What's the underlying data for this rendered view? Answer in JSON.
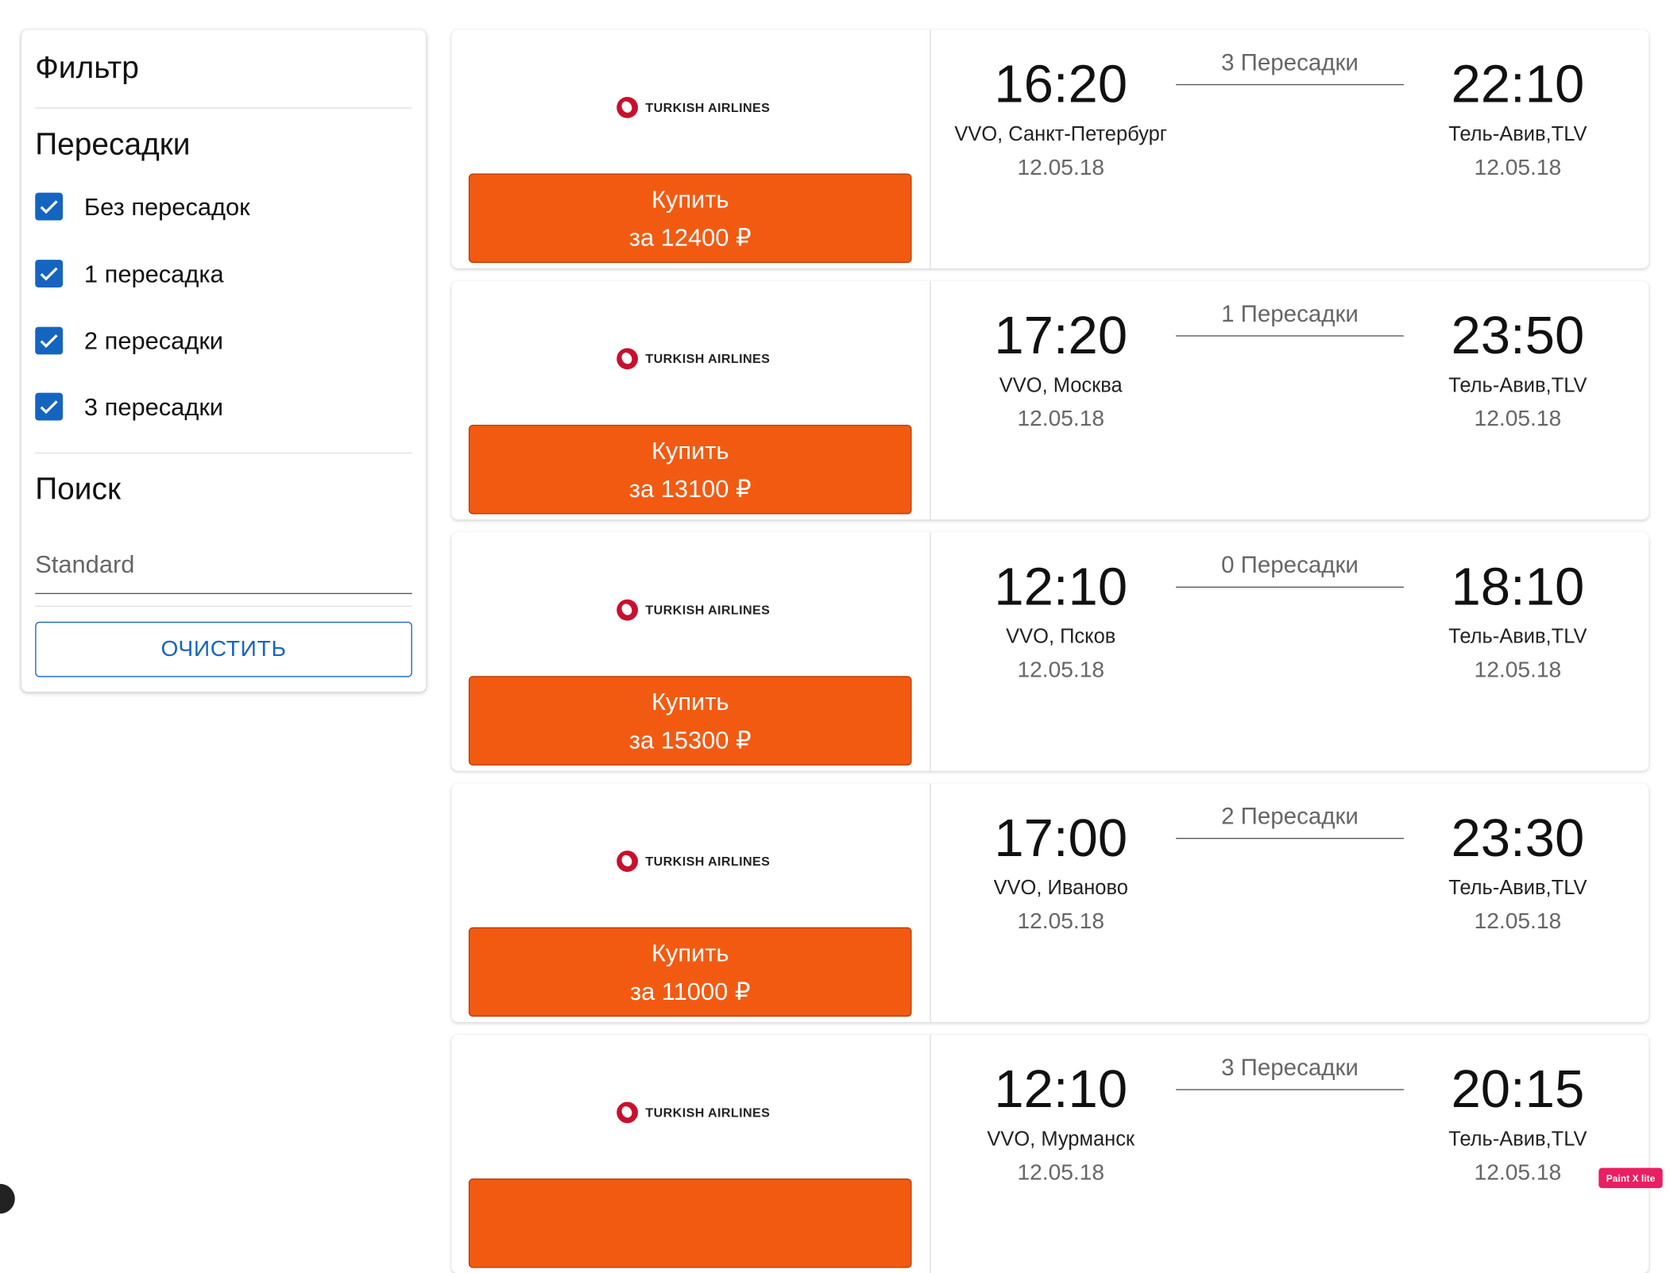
{
  "filter": {
    "title": "Фильтр",
    "stops_heading": "Пересадки",
    "options": [
      {
        "label": "Без пересадок",
        "checked": true
      },
      {
        "label": "1 пересадка",
        "checked": true
      },
      {
        "label": "2 пересадки",
        "checked": true
      },
      {
        "label": "3 пересадки",
        "checked": true
      }
    ],
    "search_heading": "Поиск",
    "search_placeholder": "Standard",
    "clear_label": "ОЧИСТИТЬ"
  },
  "tickets": [
    {
      "airline": "TURKISH AIRLINES",
      "buy_label": "Купить",
      "price_label": "за 12400 ₽",
      "stops_label": "3 Пересадки",
      "dep_time": "16:20",
      "dep_city": "VVO, Санкт-Петербург",
      "dep_date": "12.05.18",
      "arr_time": "22:10",
      "arr_city": "Тель-Авив,TLV",
      "arr_date": "12.05.18"
    },
    {
      "airline": "TURKISH AIRLINES",
      "buy_label": "Купить",
      "price_label": "за 13100 ₽",
      "stops_label": "1 Пересадки",
      "dep_time": "17:20",
      "dep_city": "VVO, Москва",
      "dep_date": "12.05.18",
      "arr_time": "23:50",
      "arr_city": "Тель-Авив,TLV",
      "arr_date": "12.05.18"
    },
    {
      "airline": "TURKISH AIRLINES",
      "buy_label": "Купить",
      "price_label": "за 15300 ₽",
      "stops_label": "0 Пересадки",
      "dep_time": "12:10",
      "dep_city": "VVO, Псков",
      "dep_date": "12.05.18",
      "arr_time": "18:10",
      "arr_city": "Тель-Авив,TLV",
      "arr_date": "12.05.18"
    },
    {
      "airline": "TURKISH AIRLINES",
      "buy_label": "Купить",
      "price_label": "за 11000 ₽",
      "stops_label": "2 Пересадки",
      "dep_time": "17:00",
      "dep_city": "VVO, Иваново",
      "dep_date": "12.05.18",
      "arr_time": "23:30",
      "arr_city": "Тель-Авив,TLV",
      "arr_date": "12.05.18"
    },
    {
      "airline": "TURKISH AIRLINES",
      "buy_label": "",
      "price_label": "",
      "stops_label": "3 Пересадки",
      "dep_time": "12:10",
      "dep_city": "VVO, Мурманск",
      "dep_date": "12.05.18",
      "arr_time": "20:15",
      "arr_city": "Тель-Авив,TLV",
      "arr_date": "12.05.18"
    }
  ],
  "badge": "Paint X lite",
  "colors": {
    "accent": "#1565c0",
    "buy": "#f25a12",
    "airline_red": "#c8102e"
  }
}
